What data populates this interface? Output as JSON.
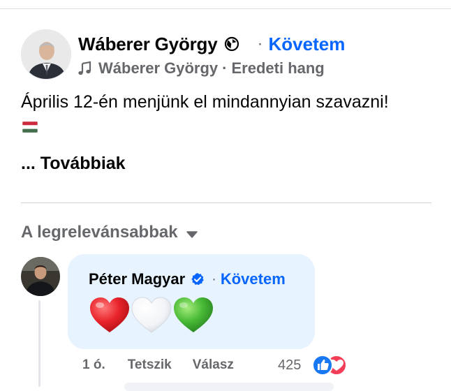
{
  "post": {
    "author": "Wáberer György",
    "separator": "·",
    "follow_label": "Követem",
    "audio_author": "Wáberer György",
    "audio_separator": "·",
    "audio_label": "Eredeti hang",
    "text": "Április 12-én menjünk el mindannyian szavazni!",
    "more_label": "... Továbbiak"
  },
  "comments": {
    "sort_label": "A legrelevánsabbak",
    "items": [
      {
        "author": "Péter Magyar",
        "separator": "·",
        "follow_label": "Követem",
        "time": "1 ó.",
        "like_label": "Tetszik",
        "reply_label": "Válasz",
        "reaction_count": "425"
      }
    ]
  },
  "colors": {
    "link_blue": "#0866ff",
    "muted_text": "#65676b",
    "bubble_bg": "#e7f3ff",
    "like_blue": "#1877f2",
    "love_red": "#f33e58"
  },
  "icons": {
    "post_privacy": "globe-icon",
    "audio": "music-note-icon",
    "flag": "hungary-flag-icon",
    "sort": "caret-down-icon",
    "verified": "verified-badge-icon",
    "hearts": [
      "red-heart-icon",
      "white-heart-icon",
      "green-heart-icon"
    ],
    "reactions": [
      "like-reaction-icon",
      "love-reaction-icon"
    ]
  }
}
